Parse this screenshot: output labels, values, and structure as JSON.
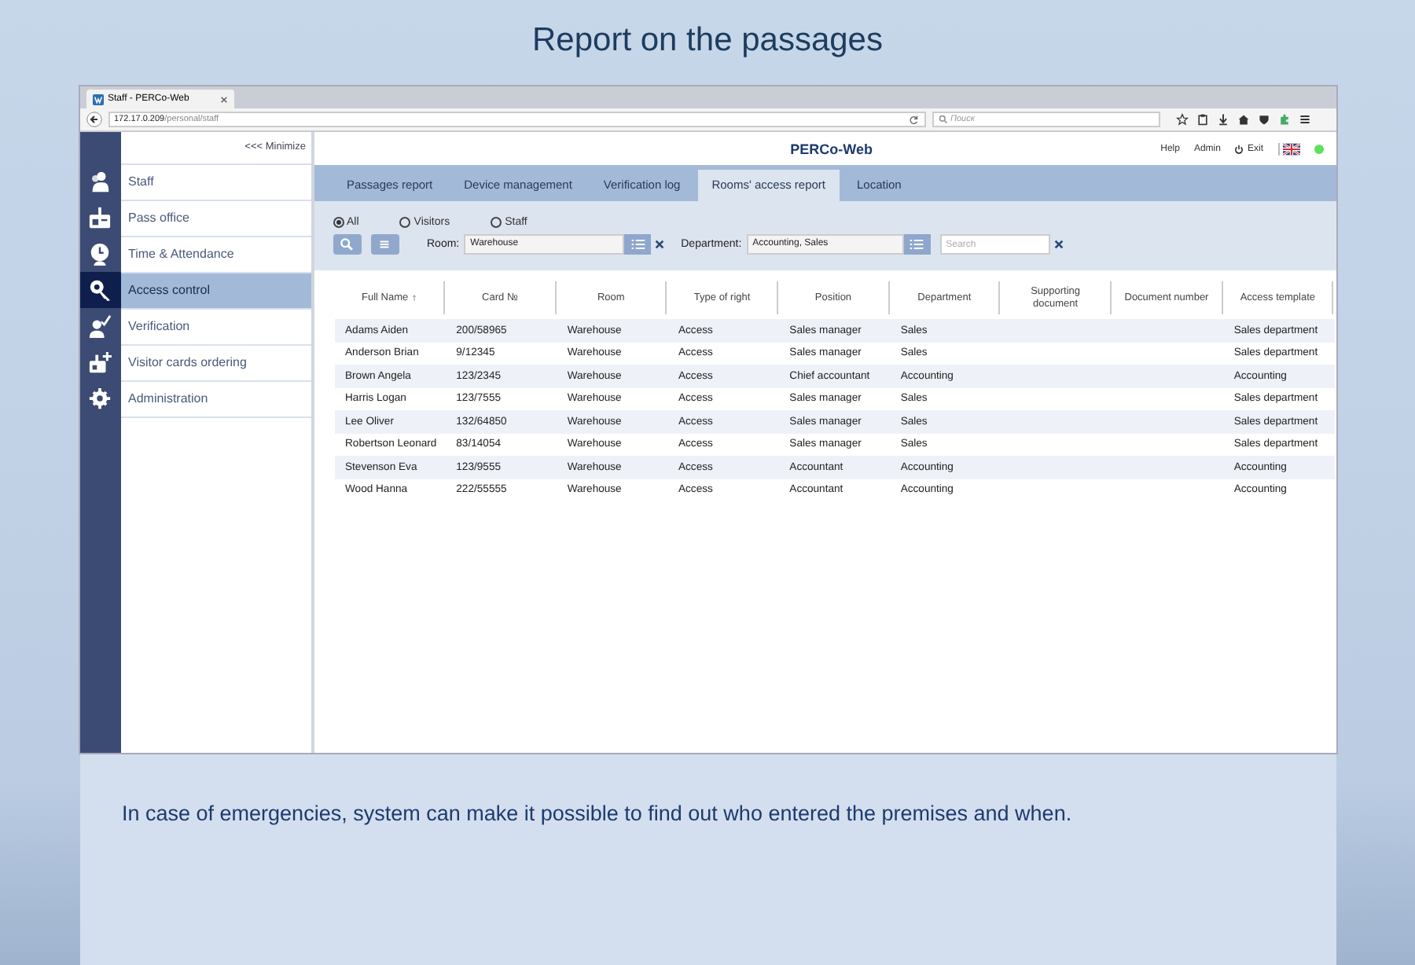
{
  "page_title": "Report on the passages",
  "browser": {
    "tab_title": "Staff - PERCo-Web",
    "url_host": "172.17.0.209",
    "url_path": "/personal/staff",
    "search_placeholder": "Поиск"
  },
  "sidebar": {
    "minimize": "<<< Minimize",
    "items": [
      {
        "label": "Staff",
        "selected": false
      },
      {
        "label": "Pass office",
        "selected": false
      },
      {
        "label": "Time & Attendance",
        "selected": false
      },
      {
        "label": "Access control",
        "selected": true
      },
      {
        "label": "Verification",
        "selected": false
      },
      {
        "label": "Visitor cards ordering",
        "selected": false
      },
      {
        "label": "Administration",
        "selected": false
      }
    ]
  },
  "header": {
    "app_title": "PERCo-Web",
    "help": "Help",
    "admin": "Admin",
    "exit": "Exit",
    "online": true
  },
  "tabs": [
    {
      "label": "Passages report",
      "selected": false
    },
    {
      "label": "Device management",
      "selected": false
    },
    {
      "label": "Verification log",
      "selected": false
    },
    {
      "label": "Rooms' access report",
      "selected": true
    },
    {
      "label": "Location",
      "selected": false
    }
  ],
  "filters": {
    "radios": [
      {
        "label": "All",
        "selected": true
      },
      {
        "label": "Visitors",
        "selected": false
      },
      {
        "label": "Staff",
        "selected": false
      }
    ],
    "room_label": "Room:",
    "room_value": "Warehouse",
    "department_label": "Department:",
    "department_value": "Accounting, Sales",
    "search_placeholder": "Search"
  },
  "table": {
    "columns": [
      {
        "label": "Full Name",
        "sorted": true
      },
      {
        "label": "Card №",
        "sorted": false
      },
      {
        "label": "Room",
        "sorted": false
      },
      {
        "label": "Type of right",
        "sorted": false
      },
      {
        "label": "Position",
        "sorted": false
      },
      {
        "label": "Department",
        "sorted": false
      },
      {
        "label": "Supporting document",
        "sorted": false
      },
      {
        "label": "Document number",
        "sorted": false
      },
      {
        "label": "Access template",
        "sorted": false
      }
    ],
    "rows": [
      [
        "Adams Aiden",
        "200/58965",
        "Warehouse",
        "Access",
        "Sales manager",
        "Sales",
        "",
        "",
        "Sales department"
      ],
      [
        "Anderson Brian",
        "9/12345",
        "Warehouse",
        "Access",
        "Sales manager",
        "Sales",
        "",
        "",
        "Sales department"
      ],
      [
        "Brown Angela",
        "123/2345",
        "Warehouse",
        "Access",
        "Chief accountant",
        "Accounting",
        "",
        "",
        "Accounting"
      ],
      [
        "Harris Logan",
        "123/7555",
        "Warehouse",
        "Access",
        "Sales manager",
        "Sales",
        "",
        "",
        "Sales department"
      ],
      [
        "Lee Oliver",
        "132/64850",
        "Warehouse",
        "Access",
        "Sales manager",
        "Sales",
        "",
        "",
        "Sales department"
      ],
      [
        "Robertson Leonard",
        "83/14054",
        "Warehouse",
        "Access",
        "Sales manager",
        "Sales",
        "",
        "",
        "Sales department"
      ],
      [
        "Stevenson Eva",
        "123/9555",
        "Warehouse",
        "Access",
        "Accountant",
        "Accounting",
        "",
        "",
        "Accounting"
      ],
      [
        "Wood Hanna",
        "222/55555",
        "Warehouse",
        "Access",
        "Accountant",
        "Accounting",
        "",
        "",
        "Accounting"
      ]
    ]
  },
  "caption": "In case of emergencies, system can make it possible to find out who entered the premises and when."
}
